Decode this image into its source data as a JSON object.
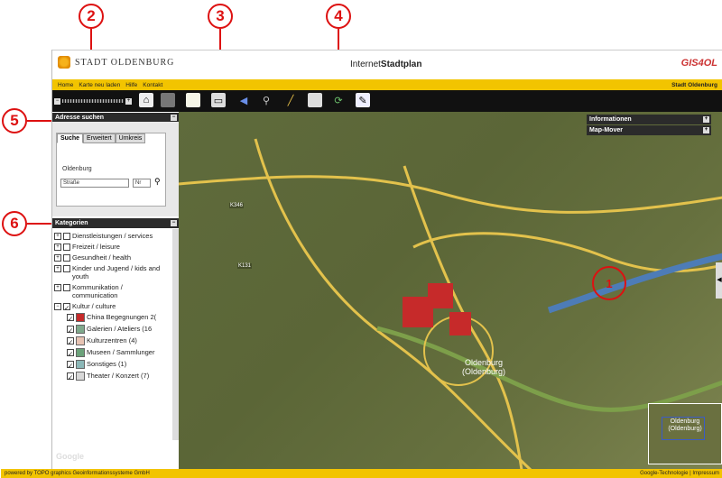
{
  "callouts": {
    "c1": "1",
    "c2": "2",
    "c3": "3",
    "c4": "4",
    "c5": "5",
    "c6": "6"
  },
  "header": {
    "logo_text": "STADT OLDENBURG",
    "title_pre": "Internet",
    "title_bold": "Stadtplan",
    "gis_logo": "GIS4OL"
  },
  "menu": {
    "items": [
      "Home",
      "Karte neu laden",
      "Hilfe",
      "Kontakt"
    ],
    "right": "Stadt Oldenburg"
  },
  "toolbar": {
    "icons": [
      "home-icon",
      "map-icon",
      "document-icon",
      "print-icon",
      "back-arrow-icon",
      "search-magnifier-icon",
      "measure-ruler-icon",
      "clipboard-icon",
      "route-icon",
      "tool-icon"
    ]
  },
  "address": {
    "title": "Adresse suchen",
    "tabs": [
      "Suche",
      "Erweitert",
      "Umkreis"
    ],
    "city": "Oldenburg",
    "street_placeholder": "Straße",
    "nr_placeholder": "Nr"
  },
  "categories": {
    "title": "Kategorien",
    "items": [
      {
        "label": "Dienstleistungen / services",
        "expander": "+"
      },
      {
        "label": "Freizeit / leisure",
        "expander": "+"
      },
      {
        "label": "Gesundheit / health",
        "expander": "+"
      },
      {
        "label": "Kinder und Jugend / kids and youth",
        "expander": "+"
      },
      {
        "label": "Kommunikation / communication",
        "expander": "+"
      },
      {
        "label": "Kultur / culture",
        "expander": "−"
      }
    ],
    "sub_items": [
      {
        "label": "China Begegnungen 2("
      },
      {
        "label": "Galerien / Ateliers (16"
      },
      {
        "label": "Kulturzentren (4)"
      },
      {
        "label": "Museen / Sammlunger"
      },
      {
        "label": "Sonstiges (1)"
      },
      {
        "label": "Theater / Konzert (7)"
      }
    ]
  },
  "right_panels": {
    "info": "Informationen",
    "mover": "Map-Mover"
  },
  "map": {
    "city_label_1": "Oldenburg",
    "city_label_2": "(Oldenburg)",
    "marker": "1",
    "overview_1": "Oldenburg",
    "overview_2": "(Oldenburg)"
  },
  "footer": {
    "left": "powered by TOPO graphics Geoinformationssysteme GmbH",
    "right": "Google-Technologie | Impressum"
  },
  "google_mark": "Google"
}
